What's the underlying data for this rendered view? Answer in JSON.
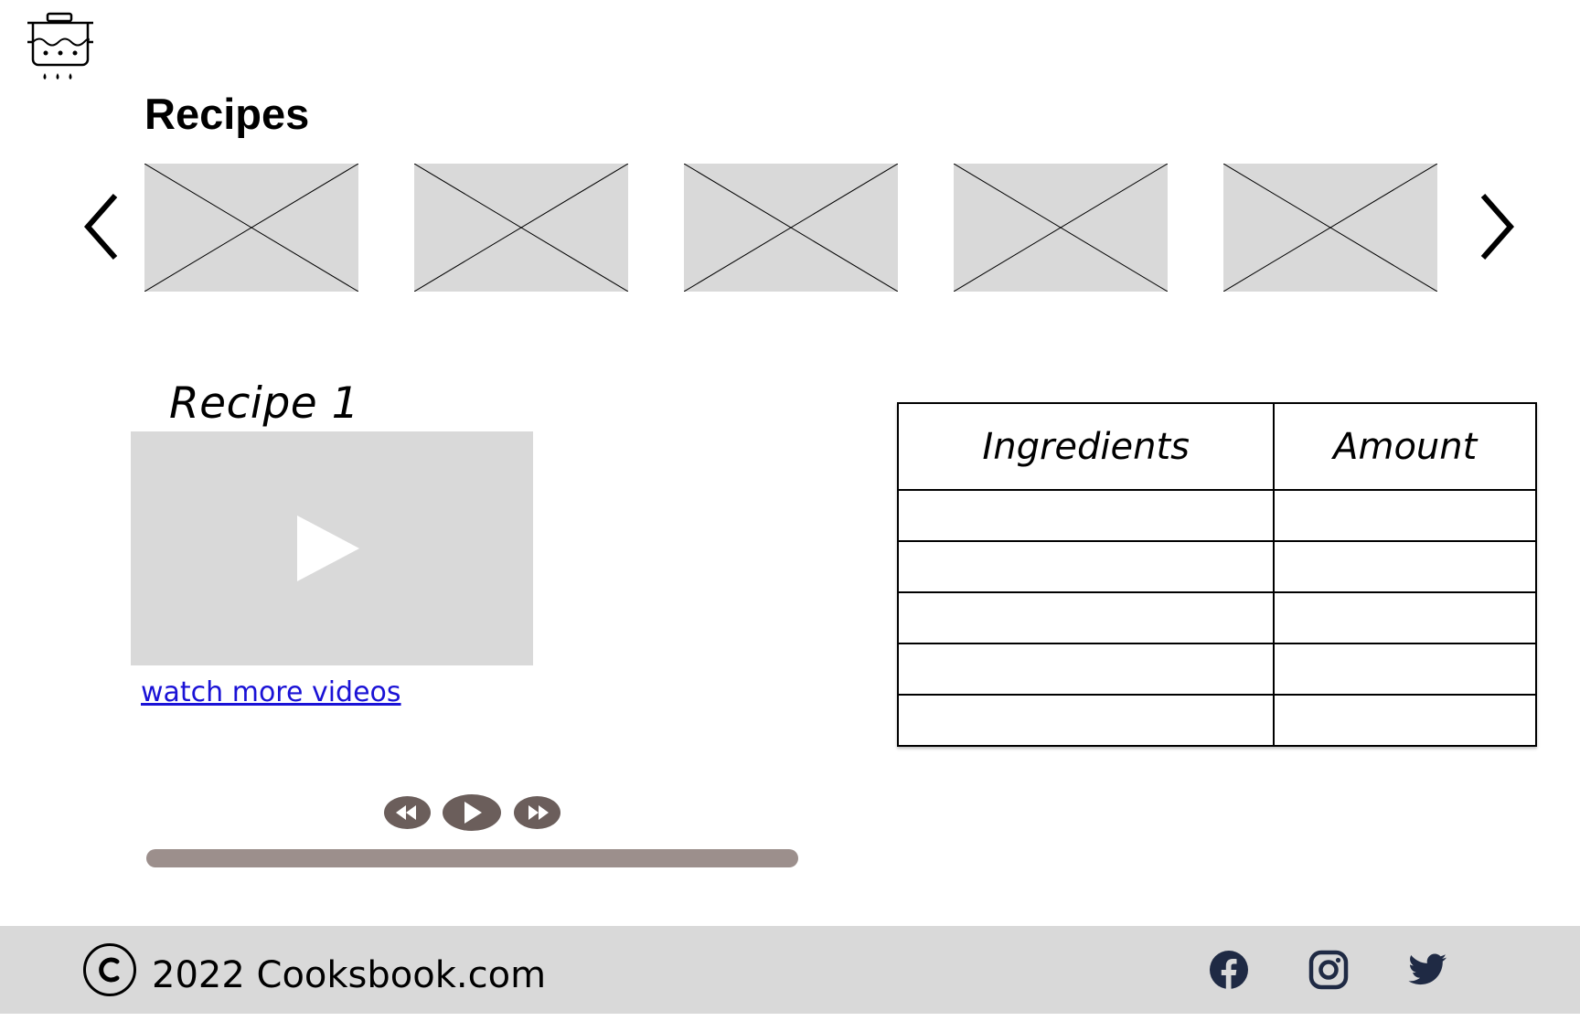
{
  "header": {
    "logo_icon": "cooking-pot-icon",
    "title": "Recipes"
  },
  "carousel": {
    "prev_icon": "chevron-left-icon",
    "next_icon": "chevron-right-icon",
    "thumbnail_count": 5,
    "thumbnail_icon": "image-placeholder-icon"
  },
  "recipe": {
    "heading": "Recipe 1",
    "video_icon": "play-icon",
    "more_videos_label": "watch more videos "
  },
  "player": {
    "rewind_icon": "rewind-icon",
    "play_icon": "play-icon",
    "forward_icon": "fast-forward-icon",
    "progress": 0
  },
  "ingredients_table": {
    "columns": [
      "Ingredients",
      "Amount"
    ],
    "rows": [
      [
        "",
        ""
      ],
      [
        "",
        ""
      ],
      [
        "",
        ""
      ],
      [
        "",
        ""
      ],
      [
        "",
        ""
      ]
    ]
  },
  "footer": {
    "copyright_icon": "copyright-icon",
    "copyright_text": "2022 Cooksbook.com",
    "social": [
      "facebook-icon",
      "instagram-icon",
      "twitter-icon"
    ]
  },
  "colors": {
    "placeholder": "#d9d9d9",
    "link": "#1a12d6",
    "player_controls": "#6b5e5b",
    "progress_track": "#9c8f8c",
    "social_icons": "#1f2a44"
  }
}
